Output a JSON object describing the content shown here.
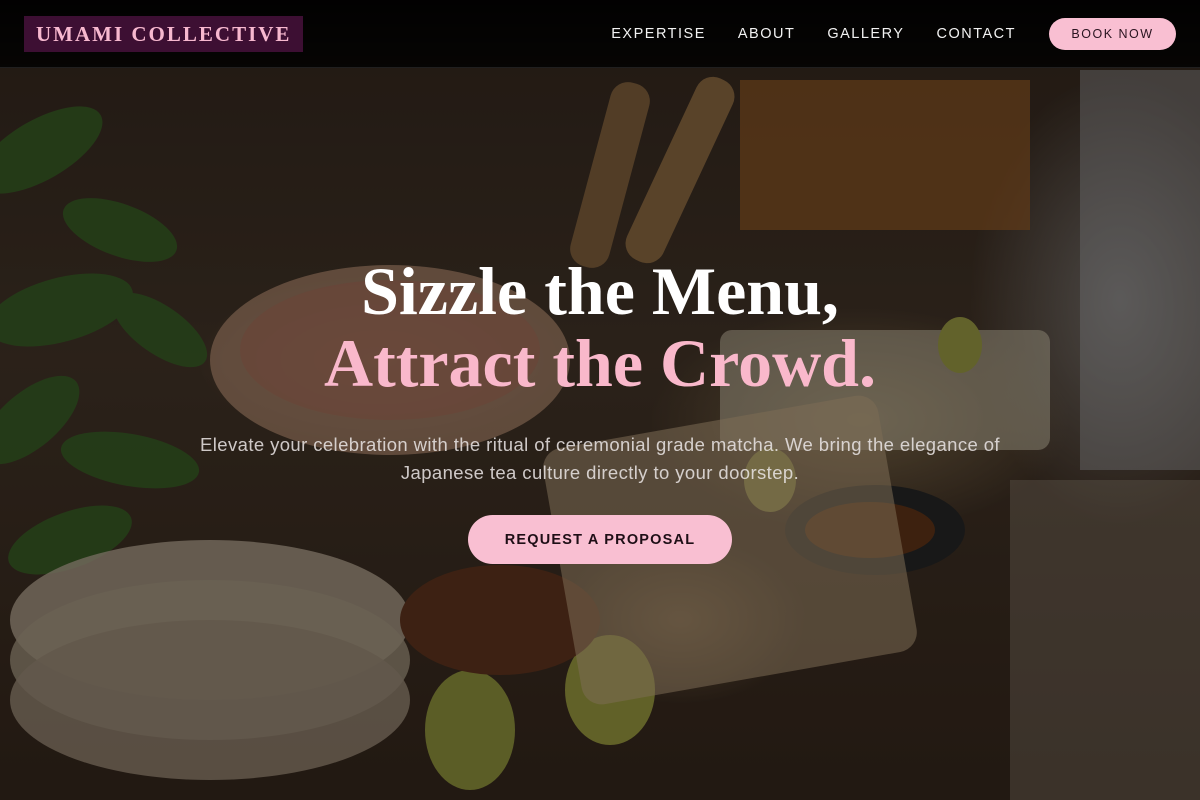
{
  "brand": {
    "name": "UMAMI COLLECTIVE"
  },
  "nav": {
    "links": [
      {
        "label": "EXPERTISE"
      },
      {
        "label": "ABOUT"
      },
      {
        "label": "GALLERY"
      },
      {
        "label": "CONTACT"
      }
    ],
    "cta_label": "BOOK NOW"
  },
  "hero": {
    "headline_line1": "Sizzle the Menu,",
    "headline_line2": "Attract the Crowd.",
    "subtitle": "Elevate your celebration with the ritual of ceremonial grade matcha. We bring the elegance of Japanese tea culture directly to your doorstep.",
    "cta_label": "REQUEST A PROPOSAL"
  },
  "colors": {
    "accent_pink": "#f9bfd2",
    "brand_bg": "#3d0f33",
    "navbar_bg": "#000000"
  }
}
